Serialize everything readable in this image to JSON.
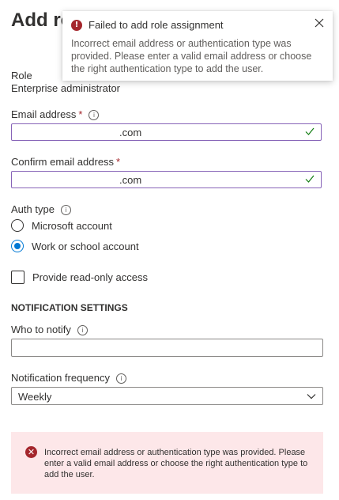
{
  "page": {
    "title": "Add ro"
  },
  "role": {
    "label": "Role",
    "value": "Enterprise administrator"
  },
  "email": {
    "label": "Email address",
    "required_mark": "*",
    "value": ".com"
  },
  "confirm_email": {
    "label": "Confirm email address",
    "required_mark": "*",
    "value": ".com"
  },
  "auth_type": {
    "label": "Auth type",
    "options": [
      {
        "label": "Microsoft account",
        "checked": false
      },
      {
        "label": "Work or school account",
        "checked": true
      }
    ]
  },
  "read_only": {
    "label": "Provide read-only access",
    "checked": false
  },
  "notification": {
    "heading": "NOTIFICATION SETTINGS",
    "who_label": "Who to notify",
    "who_value": "",
    "frequency_label": "Notification frequency",
    "frequency_value": "Weekly"
  },
  "error_banner": {
    "message": "Incorrect email address or authentication type was provided. Please enter a valid email address or choose the right authentication type to add the user."
  },
  "toast": {
    "title": "Failed to add role assignment",
    "message": "Incorrect email address or authentication type was provided. Please enter a valid email address or choose the right authentication type to add the user."
  },
  "colors": {
    "accent": "#0078d4",
    "error": "#a4262c",
    "valid": "#107c10",
    "error_bg": "#fde7e9"
  }
}
